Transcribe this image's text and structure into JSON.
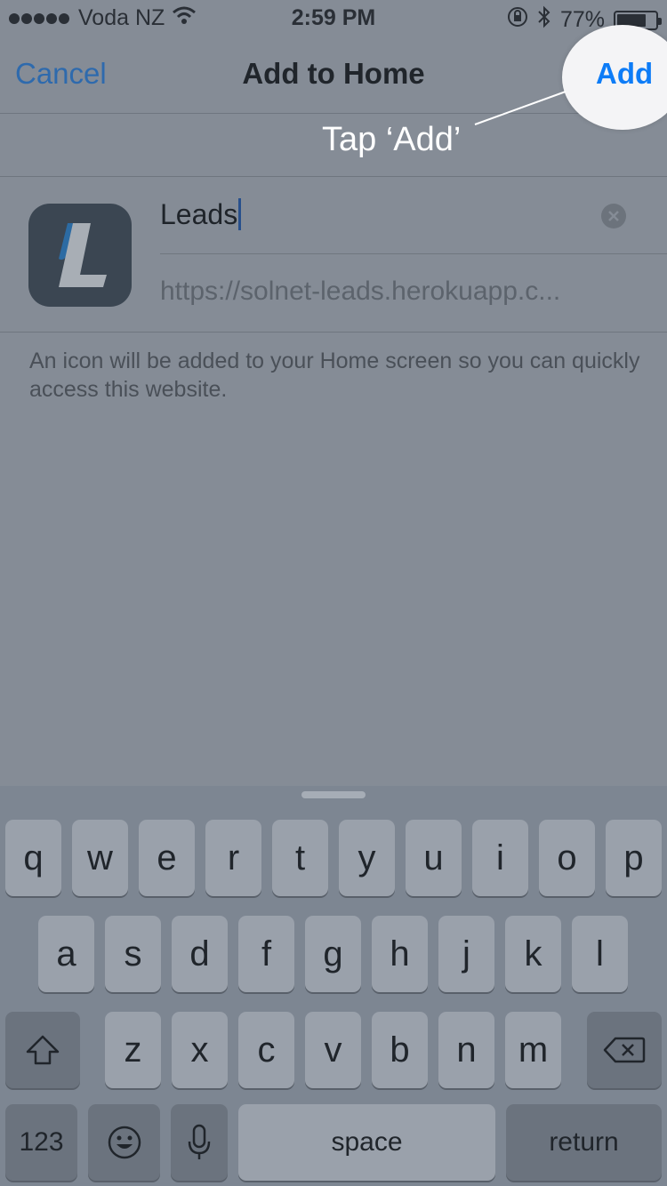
{
  "status_bar": {
    "carrier": "Voda NZ",
    "time": "2:59 PM",
    "battery_percent": "77%",
    "battery_level": 0.77,
    "icons": [
      "signal-dots-icon",
      "wifi-icon",
      "orientation-lock-icon",
      "bluetooth-icon",
      "battery-icon"
    ]
  },
  "nav": {
    "cancel_label": "Cancel",
    "title": "Add to Home",
    "add_label": "Add"
  },
  "callout": {
    "text": "Tap ‘Add’"
  },
  "form": {
    "name_value": "Leads",
    "url_value": "https://solnet-leads.herokuapp.c...",
    "app_icon_letter": "L",
    "info_text": "An icon will be added to your Home screen so you can quickly access this website."
  },
  "keyboard": {
    "row1": [
      "q",
      "w",
      "e",
      "r",
      "t",
      "y",
      "u",
      "i",
      "o",
      "p"
    ],
    "row2": [
      "a",
      "s",
      "d",
      "f",
      "g",
      "h",
      "j",
      "k",
      "l"
    ],
    "row3": [
      "z",
      "x",
      "c",
      "v",
      "b",
      "n",
      "m"
    ],
    "numbers_label": "123",
    "space_label": "space",
    "return_label": "return"
  },
  "colors": {
    "accent": "#0d7cf7",
    "cancel": "#2e6aad",
    "background": "#858c96"
  }
}
